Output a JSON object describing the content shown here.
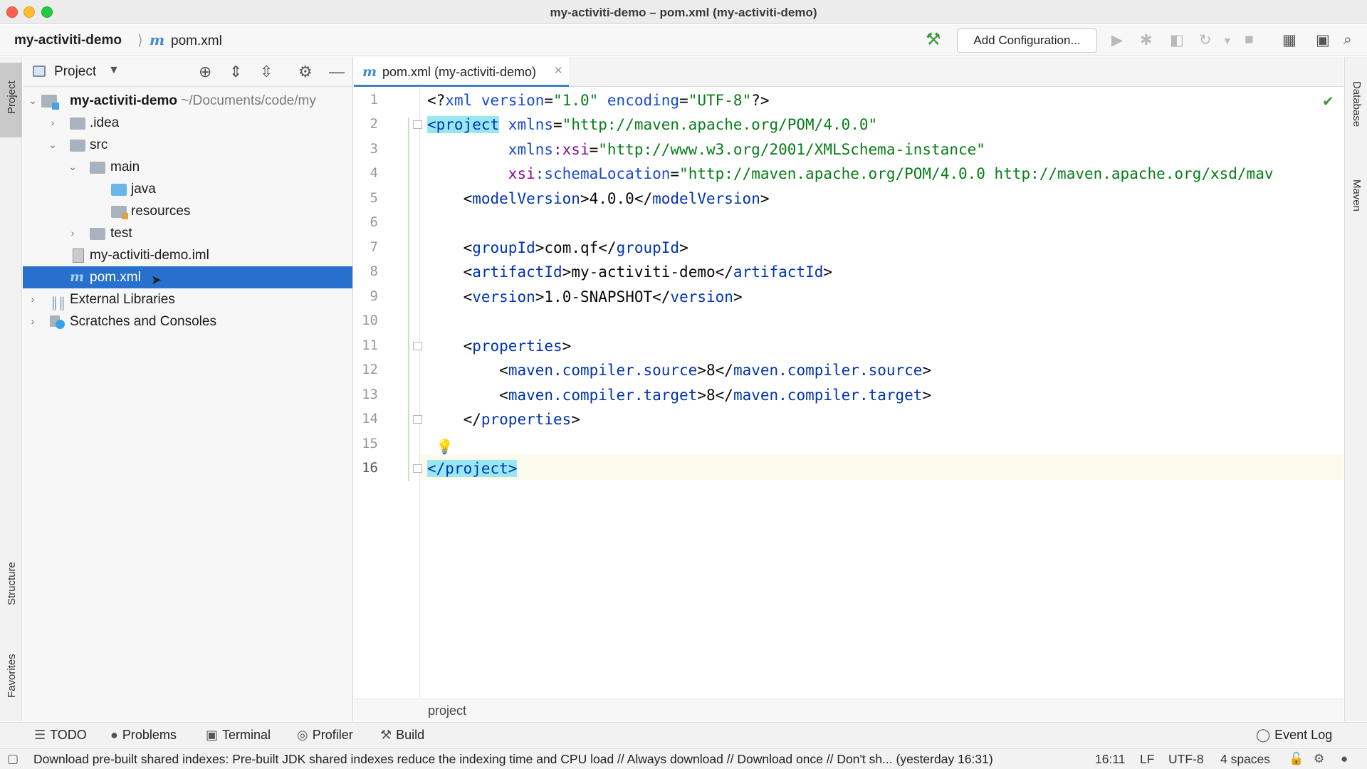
{
  "window": {
    "title": "my-activiti-demo – pom.xml (my-activiti-demo)"
  },
  "navbar": {
    "project": "my-activiti-demo",
    "file_icon": "m",
    "file": "pom.xml",
    "add_configuration": "Add Configuration..."
  },
  "left_strip": {
    "project": "Project",
    "structure": "Structure",
    "favorites": "Favorites"
  },
  "right_strip": {
    "database": "Database",
    "maven": "Maven"
  },
  "project_panel": {
    "title": "Project",
    "tree": [
      {
        "label": "my-activiti-demo",
        "path": "~/Documents/code/my"
      },
      {
        "label": ".idea"
      },
      {
        "label": "src"
      },
      {
        "label": "main"
      },
      {
        "label": "java"
      },
      {
        "label": "resources"
      },
      {
        "label": "test"
      },
      {
        "label": "my-activiti-demo.iml"
      },
      {
        "label": "pom.xml"
      },
      {
        "label": "External Libraries"
      },
      {
        "label": "Scratches and Consoles"
      }
    ]
  },
  "editor": {
    "tab_icon": "m",
    "tab": "pom.xml (my-activiti-demo)",
    "line_numbers": [
      "1",
      "2",
      "3",
      "4",
      "5",
      "6",
      "7",
      "8",
      "9",
      "10",
      "11",
      "12",
      "13",
      "14",
      "15",
      "16"
    ],
    "code": {
      "l1": {
        "a": "<?",
        "b": "xml",
        "c": " version",
        "d": "=",
        "e": "\"1.0\"",
        "f": " encoding",
        "g": "=",
        "h": "\"UTF-8\"",
        "i": "?>"
      },
      "l2": {
        "a": "<project",
        "b": " xmlns",
        "c": "=",
        "d": "\"http://maven.apache.org/POM/4.0.0\""
      },
      "l3": {
        "indent": "         ",
        "a": "xmlns",
        "b": ":xsi",
        "c": "=",
        "d": "\"http://www.w3.org/2001/XMLSchema-instance\""
      },
      "l4": {
        "indent": "         ",
        "a": "xsi",
        "b": ":schemaLocation",
        "c": "=",
        "d": "\"http://maven.apache.org/POM/4.0.0 http://maven.apache.org/xsd/mav"
      },
      "l5": {
        "indent": "    ",
        "a": "<",
        "b": "modelVersion",
        "c": ">",
        "d": "4.0.0",
        "e": "</",
        "f": "modelVersion",
        "g": ">"
      },
      "l7": {
        "indent": "    ",
        "a": "<",
        "b": "groupId",
        "c": ">",
        "d": "com.qf",
        "e": "</",
        "f": "groupId",
        "g": ">"
      },
      "l8": {
        "indent": "    ",
        "a": "<",
        "b": "artifactId",
        "c": ">",
        "d": "my-activiti-demo",
        "e": "</",
        "f": "artifactId",
        "g": ">"
      },
      "l9": {
        "indent": "    ",
        "a": "<",
        "b": "version",
        "c": ">",
        "d": "1.0-SNAPSHOT",
        "e": "</",
        "f": "version",
        "g": ">"
      },
      "l11": {
        "indent": "    ",
        "a": "<",
        "b": "properties",
        "c": ">"
      },
      "l12": {
        "indent": "        ",
        "a": "<",
        "b": "maven.compiler.source",
        "c": ">",
        "d": "8",
        "e": "</",
        "f": "maven.compiler.source",
        "g": ">"
      },
      "l13": {
        "indent": "        ",
        "a": "<",
        "b": "maven.compiler.target",
        "c": ">",
        "d": "8",
        "e": "</",
        "f": "maven.compiler.target",
        "g": ">"
      },
      "l14": {
        "indent": "    ",
        "a": "</",
        "b": "properties",
        "c": ">"
      },
      "l16": {
        "a": "</project>"
      }
    },
    "breadcrumb": "project"
  },
  "bottom_tools": {
    "todo": "TODO",
    "problems": "Problems",
    "terminal": "Terminal",
    "profiler": "Profiler",
    "build": "Build",
    "event_log": "Event Log"
  },
  "status": {
    "message": "Download pre-built shared indexes: Pre-built JDK shared indexes reduce the indexing time and CPU load // Always download // Download once // Don't sh... (yesterday 16:31)",
    "position": "16:11",
    "line_sep": "LF",
    "encoding": "UTF-8",
    "indent": "4 spaces"
  },
  "colors": {
    "selection": "#2770cd",
    "tag": "#0033b3",
    "string": "#067d17",
    "namespace": "#871094"
  }
}
